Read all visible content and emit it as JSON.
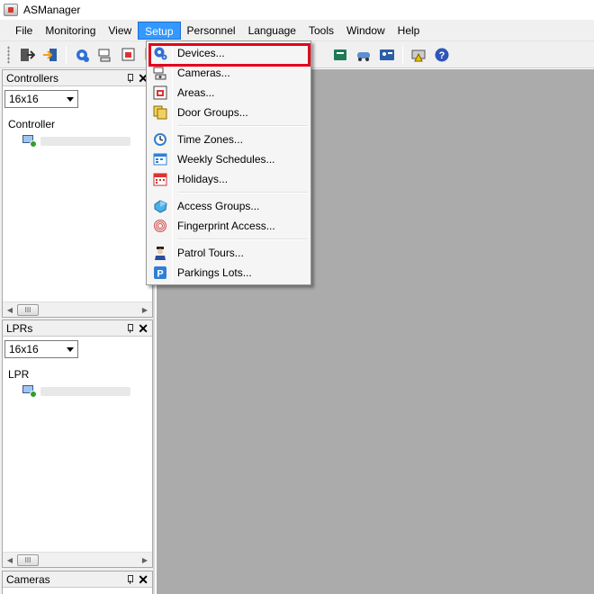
{
  "window": {
    "title": "ASManager"
  },
  "menubar": {
    "items": [
      "File",
      "Monitoring",
      "View",
      "Setup",
      "Personnel",
      "Language",
      "Tools",
      "Window",
      "Help"
    ],
    "active": "Setup"
  },
  "toolbar": {
    "icons": [
      "exit-icon",
      "login-icon",
      "devices-icon",
      "cameras-icon",
      "areas-icon",
      "door-groups-icon",
      "cardholder-icon",
      "vehicle-icon",
      "id-card-icon",
      "alarm-icon",
      "help-icon"
    ]
  },
  "setup_menu": {
    "groups": [
      [
        {
          "label": "Devices...",
          "icon": "devices-icon",
          "highlighted": true
        },
        {
          "label": "Cameras...",
          "icon": "cameras-icon"
        },
        {
          "label": "Areas...",
          "icon": "areas-icon"
        },
        {
          "label": "Door Groups...",
          "icon": "door-groups-icon"
        }
      ],
      [
        {
          "label": "Time Zones...",
          "icon": "clock-icon"
        },
        {
          "label": "Weekly Schedules...",
          "icon": "weekly-schedule-icon"
        },
        {
          "label": "Holidays...",
          "icon": "calendar-icon"
        }
      ],
      [
        {
          "label": "Access Groups...",
          "icon": "access-group-icon"
        },
        {
          "label": "Fingerprint Access...",
          "icon": "fingerprint-icon"
        }
      ],
      [
        {
          "label": "Patrol Tours...",
          "icon": "guard-icon"
        },
        {
          "label": "Parkings Lots...",
          "icon": "parking-icon"
        }
      ]
    ]
  },
  "panels": {
    "controllers": {
      "title": "Controllers",
      "grid_size": "16x16",
      "column": "Controller"
    },
    "lprs": {
      "title": "LPRs",
      "grid_size": "16x16",
      "column": "LPR"
    },
    "cameras": {
      "title": "Cameras"
    }
  },
  "colors": {
    "workspace": "#ababab",
    "menu_active": "#3399ff",
    "highlight": "#e3001b"
  }
}
